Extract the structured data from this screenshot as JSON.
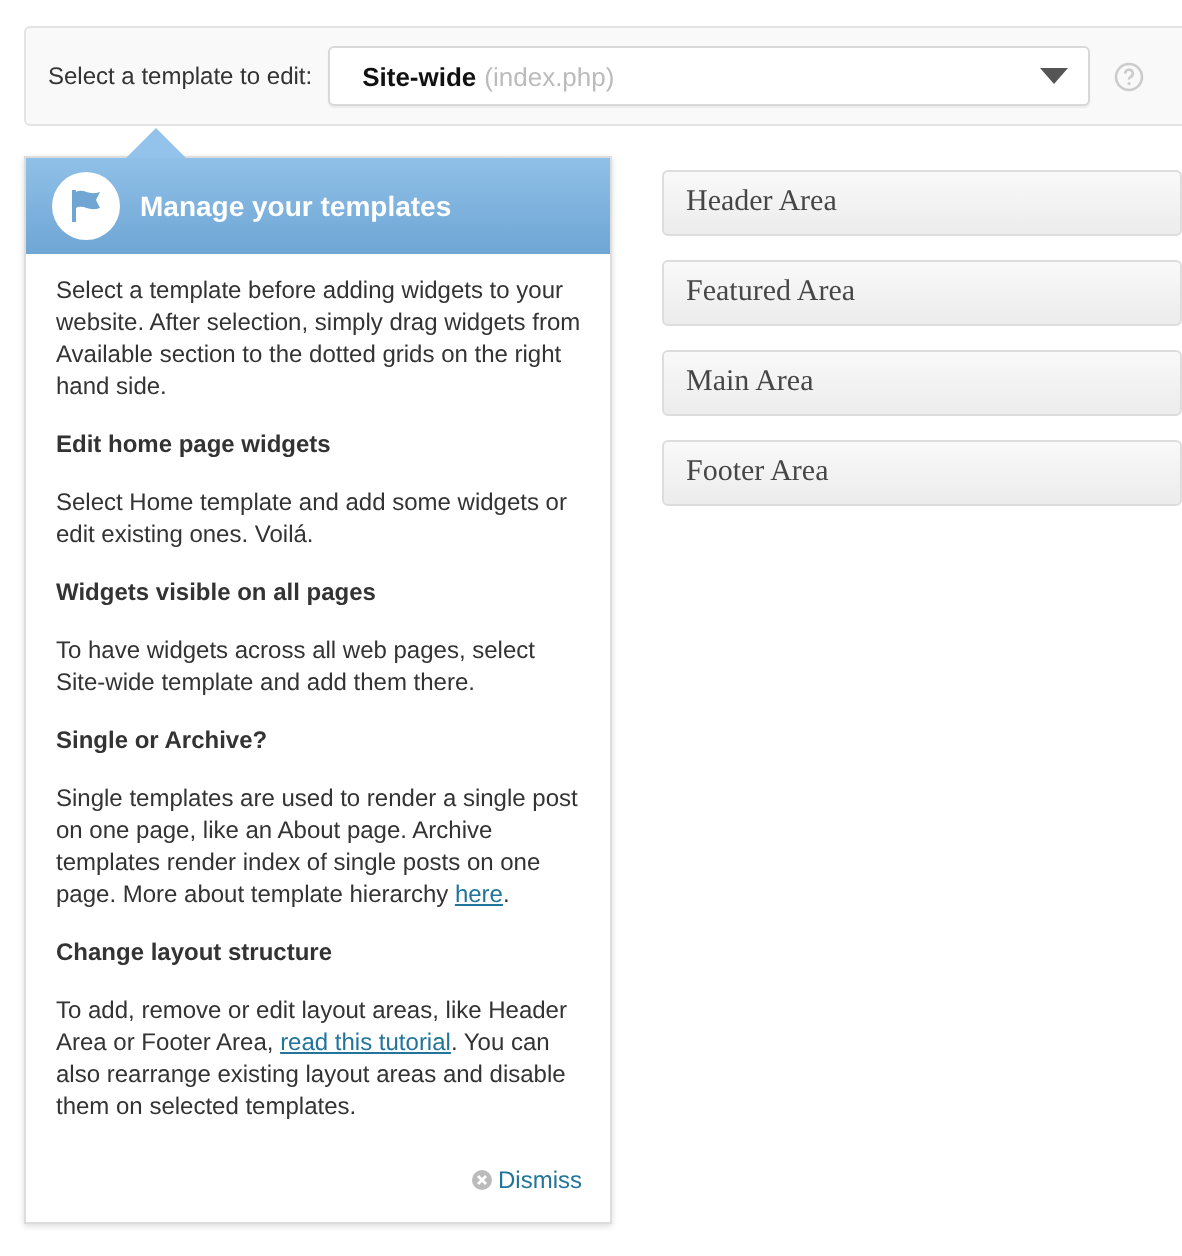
{
  "template_bar": {
    "label": "Select a template to edit:",
    "select": {
      "value": "Site-wide",
      "hint": "(index.php)"
    }
  },
  "help_popup": {
    "title": "Manage your templates",
    "blocks": [
      {
        "kind": "text",
        "text": "Select a template before adding widgets to your website. After selection, simply drag widgets from Available section to the dotted grids on the right hand side."
      },
      {
        "kind": "heading",
        "text": "Edit home page widgets"
      },
      {
        "kind": "text",
        "text": "Select Home template and add some widgets or edit existing ones. Voilá."
      },
      {
        "kind": "heading",
        "text": "Widgets visible on all pages"
      },
      {
        "kind": "text",
        "text": "To have widgets across all web pages, select Site-wide template and add them there."
      },
      {
        "kind": "heading",
        "text": "Single or Archive?"
      },
      {
        "kind": "text",
        "text": "Single templates are used to render a single post on one page, like an About page. Archive templates render index of single posts on one page. More about template hierarchy ",
        "link": "here",
        "after": "."
      },
      {
        "kind": "heading",
        "text": "Change layout structure"
      },
      {
        "kind": "text",
        "text": "To add, remove or edit layout areas, like Header Area or Footer Area, ",
        "link": "read this tutorial",
        "after": ". You can also rearrange existing layout areas and disable them on selected templates."
      }
    ],
    "dismiss": "Dismiss"
  },
  "layout_areas": [
    "Header Area",
    "Featured Area",
    "Main Area",
    "Footer Area"
  ]
}
